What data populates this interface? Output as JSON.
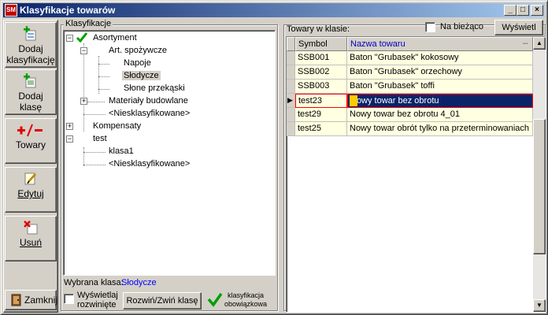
{
  "window": {
    "title": "Klasyfikacje towarów",
    "app_icon_text": "SM",
    "minimize_glyph": "_",
    "maximize_glyph": "□",
    "close_glyph": "×"
  },
  "toolbar": {
    "add_classification_line1": "Dodaj",
    "add_classification_line2": "klasyfikację",
    "add_class_line1": "Dodaj",
    "add_class_line2": "klasę",
    "goods_label": "Towary",
    "edit_label": "Edytuj",
    "delete_label": "Usuń",
    "close_label": "Zamknij"
  },
  "tree": {
    "caption": "Klasyfikacje",
    "nodes": [
      {
        "label": "Asortyment"
      },
      {
        "label": "Art. spożywcze"
      },
      {
        "label": "Napoje"
      },
      {
        "label": "Słodycze"
      },
      {
        "label": "Słone przekąski"
      },
      {
        "label": "Materiały budowlane"
      },
      {
        "label": "<Niesklasyfikowane>"
      },
      {
        "label": "Kompensaty"
      },
      {
        "label": "test"
      },
      {
        "label": "klasa1"
      },
      {
        "label": "<Niesklasyfikowane>"
      }
    ],
    "selected_class_label": "Wybrana klasa:",
    "selected_class_value": "Słodycze",
    "show_expanded_line1": "Wyświetlaj",
    "show_expanded_line2": "rozwinięte",
    "expand_collapse_button": "Rozwiń/Zwiń klasę",
    "mandatory_line1": "klasyfikacja",
    "mandatory_line2": "obowiązkowa"
  },
  "goods": {
    "caption": "Towary w klasie:",
    "live_checkbox_label": "Na bieżąco",
    "show_button": "Wyświetl",
    "columns": [
      "Symbol",
      "Nazwa towaru"
    ],
    "rows": [
      {
        "symbol": "SSB001",
        "name": "Baton \"Grubasek\" kokosowy"
      },
      {
        "symbol": "SSB002",
        "name": "Baton \"Grubasek\" orzechowy"
      },
      {
        "symbol": "SSB003",
        "name": "Baton \"Grubasek\" toffi"
      },
      {
        "symbol": "test23",
        "name": "Nowy towar bez obrotu"
      },
      {
        "symbol": "test29",
        "name": "Nowy towar bez obrotu 4_01"
      },
      {
        "symbol": "test25",
        "name": "Nowy towar obrót tylko na przeterminowaniach"
      }
    ],
    "current_row_marker": "▶"
  },
  "colors": {
    "title_start": "#0a246a",
    "title_end": "#a6caf0",
    "row_bg": "#ffffe1",
    "selected_row_bg": "#0a246a",
    "selected_border": "#ff0000",
    "column_header_text": "#0000c0",
    "selected_class_text": "#0000ff",
    "check_green": "#00a000"
  }
}
